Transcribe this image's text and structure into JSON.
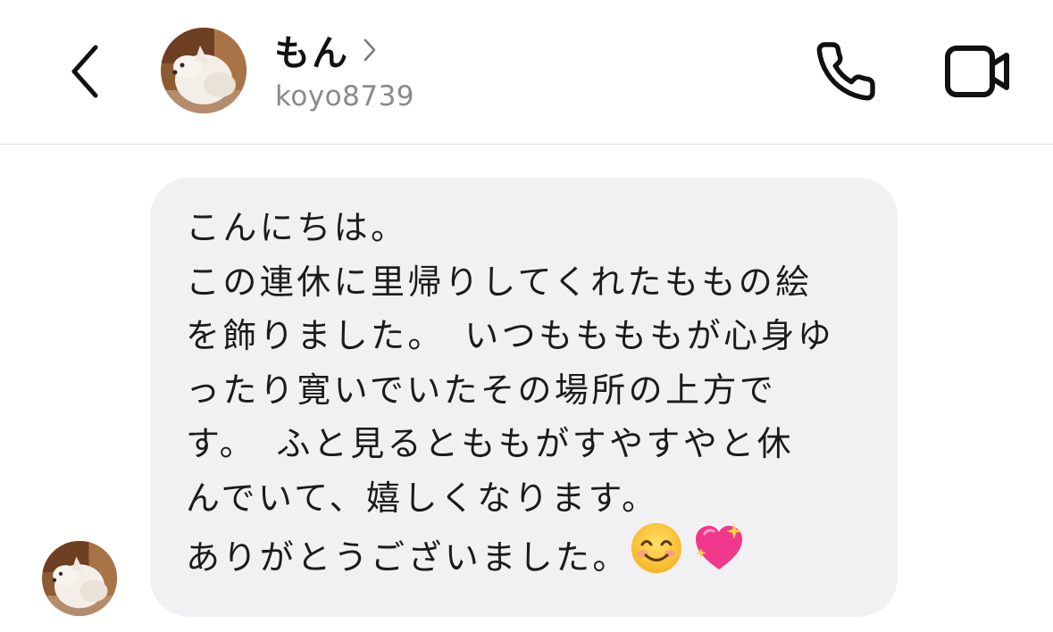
{
  "header": {
    "contact_name": "もん",
    "username": "koyo8739",
    "icons": {
      "back": "chevron-left-icon",
      "name_chevron": "chevron-right-icon",
      "phone": "phone-icon",
      "video": "video-camera-icon"
    }
  },
  "conversation": {
    "messages": [
      {
        "direction": "incoming",
        "lines": [
          "こんにちは。",
          "この連休に里帰りしてくれたももの絵",
          "を飾りました。　いつももももが心身ゆ",
          "ったり寛いでいたその場所の上方で",
          "す。　ふと見るとももがすやすやと休",
          "んでいて、嬉しくなります。",
          "ありがとうございました。"
        ],
        "trailing_emojis": [
          "smiling-face-emoji",
          "sparkling-heart-emoji"
        ]
      }
    ]
  },
  "colors": {
    "bubble_bg": "#f1f1f4",
    "secondary_text": "#8a8a8e",
    "divider": "#e4e4e6"
  }
}
